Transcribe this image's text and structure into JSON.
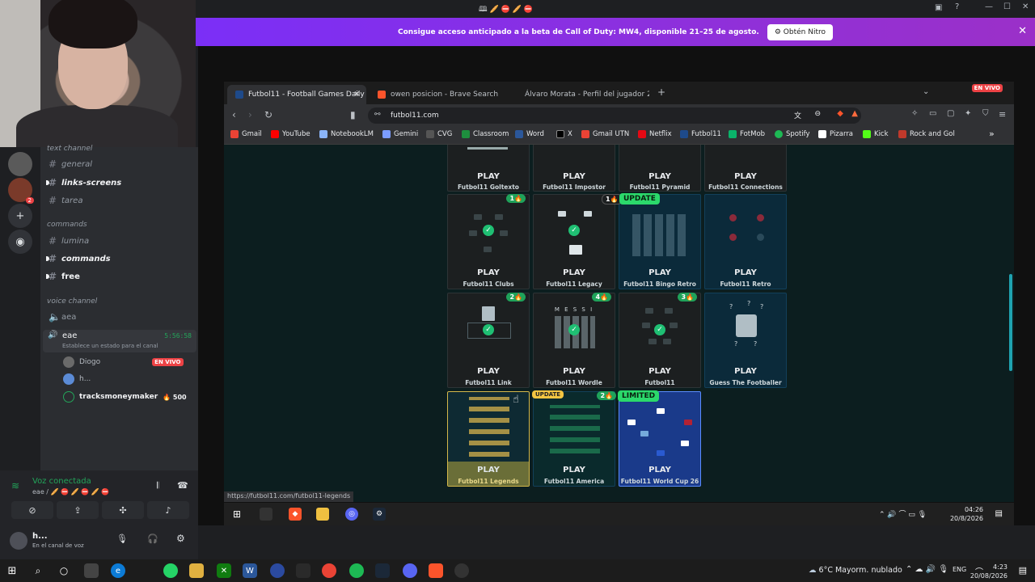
{
  "discord": {
    "top_icons": "🕮 🥖 ⛔ 🥖 ⛔",
    "nitro_banner": {
      "text": "Consigue acceso anticipado a la beta de Call of Duty: MW4, disponible 21–25 de agosto.",
      "button": "Obtén Nitro",
      "close": "✕"
    },
    "categories": {
      "text": "text channel",
      "commands": "commands",
      "voice": "voice channel"
    },
    "channels": {
      "general": "general",
      "links_screens": "links-screens",
      "tarea": "tarea",
      "lumina": "lumina",
      "commands": "commands",
      "free": "free",
      "aea": "aea",
      "eae": "eae",
      "eae_time": "5:56:58",
      "eae_status": "Establece un estado para el canal"
    },
    "voice_users": [
      {
        "name": "Diogo",
        "badge": "EN VIVO"
      },
      {
        "name": "h..."
      },
      {
        "name": "tracksmoneymaker",
        "count": "500"
      }
    ],
    "voice_panel": {
      "title": "Voz conectada",
      "sub": "eae / 🥖 ⛔ 🥖 ⛔ 🥖 ⛔",
      "user": "h...",
      "user_status": "En el canal de voz"
    },
    "rail_badge": "2"
  },
  "browser": {
    "tabs": [
      {
        "label": "Futbol11 - Football Games Daily",
        "active": true
      },
      {
        "label": "owen posicion - Brave Search"
      },
      {
        "label": "Álvaro Morata - Perfil del jugador 26"
      }
    ],
    "new_tab": "+",
    "live_badge": "EN VIVO",
    "url": "futbol11.com",
    "bookmarks": [
      "Gmail",
      "YouTube",
      "NotebookLM",
      "Gemini",
      "CVG",
      "Classroom",
      "Word",
      "X",
      "Gmail UTN",
      "Netflix",
      "Futbol11",
      "FotMob",
      "Spotify",
      "Pizarra",
      "Kick",
      "Rock and Gol"
    ],
    "bookmarks_more": "»",
    "status_url": "https://futbol11.com/futbol11-legends"
  },
  "games": {
    "play_label": "PLAY",
    "row1": [
      "Futbol11 Goltexto",
      "Futbol11 Impostor",
      "Futbol11 Pyramid",
      "Futbol11 Connections"
    ],
    "row2": [
      {
        "name": "Futbol11 Clubs",
        "badge": "1🔥"
      },
      {
        "name": "Futbol11 Legacy"
      },
      {
        "name": "Futbol11 Bingo Retro",
        "badge": "1🔥",
        "tag": "UPDATE"
      },
      {
        "name": "Futbol11 Retro"
      }
    ],
    "row3": [
      {
        "name": "Futbol11 Link",
        "badge": "2🔥"
      },
      {
        "name": "Futbol11 Wordle",
        "badge": "4🔥",
        "letters": "M E S S I"
      },
      {
        "name": "Futbol11",
        "badge": "3🔥"
      },
      {
        "name": "Guess The Footballer"
      }
    ],
    "row4": [
      {
        "name": "Futbol11 Legends"
      },
      {
        "name": "Futbol11 America",
        "badge": "2🔥",
        "tag": "UPDATE"
      },
      {
        "name": "Futbol11 World Cup 26",
        "tag": "LIMITED"
      }
    ]
  },
  "stream_taskbar": {
    "time": "04:26",
    "date": "20/8/2026"
  },
  "taskbar": {
    "weather": "6°C  Mayorm. nublado",
    "lang": "ENG",
    "time": "4:23",
    "date": "20/08/2026"
  }
}
